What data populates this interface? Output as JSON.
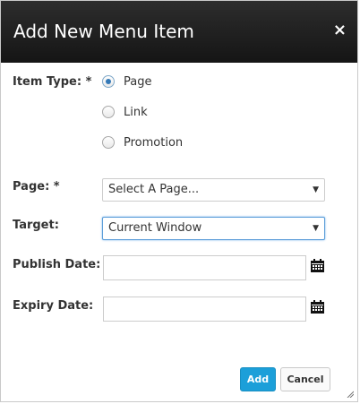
{
  "dialog": {
    "title": "Add New Menu Item",
    "close_label": "×"
  },
  "form": {
    "item_type": {
      "label": "Item Type: *",
      "options": [
        {
          "label": "Page",
          "checked": true
        },
        {
          "label": "Link",
          "checked": false
        },
        {
          "label": "Promotion",
          "checked": false
        }
      ]
    },
    "page": {
      "label": "Page: *",
      "value": "Select A Page..."
    },
    "target": {
      "label": "Target:",
      "value": "Current Window"
    },
    "publish_date": {
      "label": "Publish Date:",
      "value": ""
    },
    "expiry_date": {
      "label": "Expiry Date:",
      "value": ""
    }
  },
  "buttons": {
    "add": "Add",
    "cancel": "Cancel"
  },
  "icons": {
    "close": "close-icon",
    "calendar": "calendar-icon",
    "dropdown": "chevron-down-icon",
    "resize": "resize-grip-icon"
  },
  "colors": {
    "titlebar": "#1e1e1e",
    "accent": "#1c9fd9",
    "focus_border": "#5b9dd9",
    "radio_checked": "#3479b7"
  }
}
